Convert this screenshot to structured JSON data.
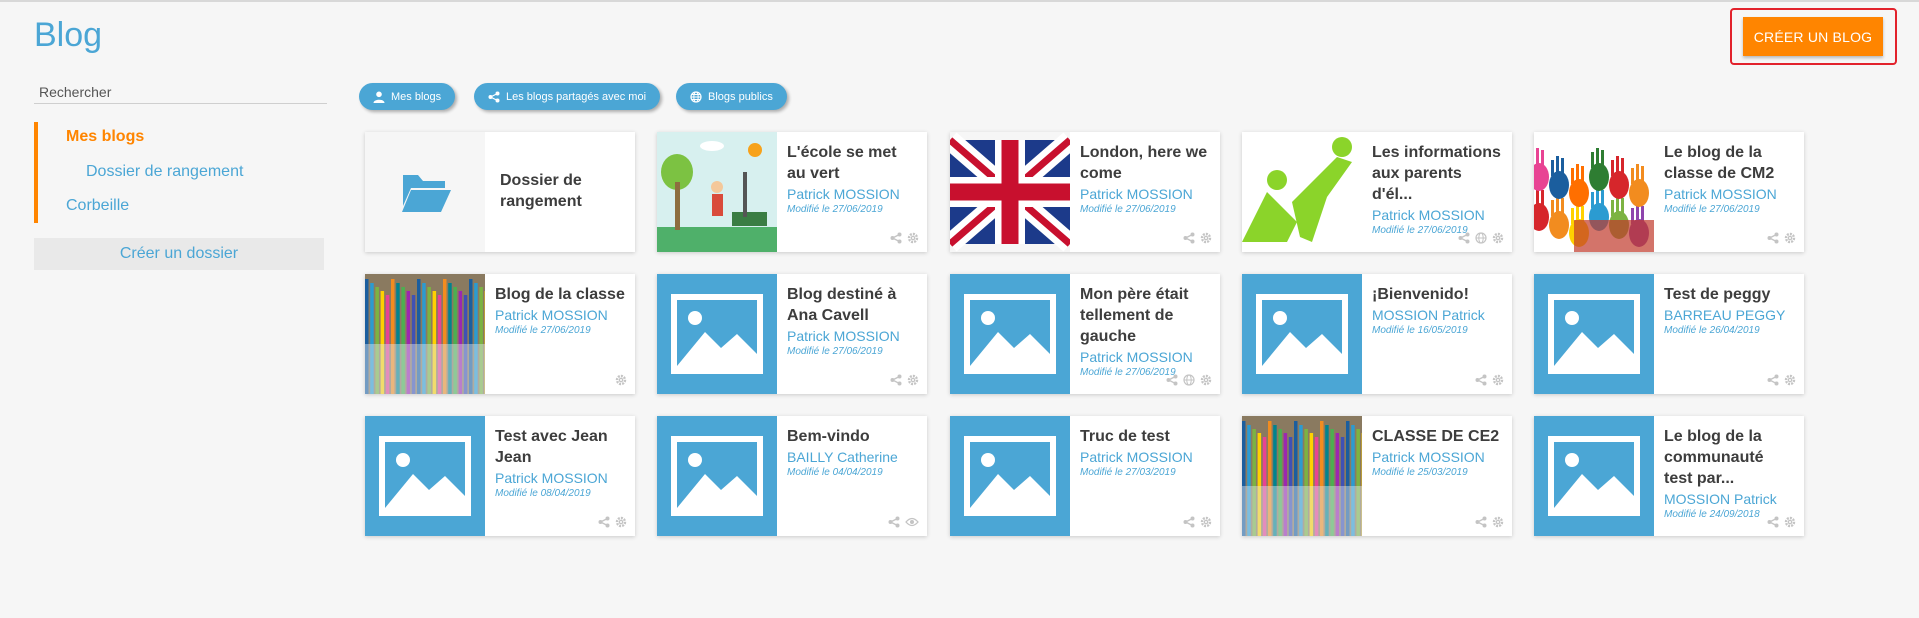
{
  "page": {
    "title": "Blog",
    "create_blog": "CRÉER UN BLOG"
  },
  "search": {
    "placeholder": "Rechercher"
  },
  "sidebar": {
    "items": [
      {
        "label": "Mes blogs",
        "active": true
      },
      {
        "label": "Dossier de rangement"
      },
      {
        "label": "Corbeille"
      }
    ],
    "create_folder": "Créer un dossier"
  },
  "filters": [
    {
      "label": "Mes blogs",
      "icon": "user-icon"
    },
    {
      "label": "Les blogs partagés avec moi",
      "icon": "share-icon"
    },
    {
      "label": "Blogs publics",
      "icon": "globe-icon"
    }
  ],
  "folder_card": {
    "title": "Dossier de rangement",
    "icon": "folder-open-icon"
  },
  "blogs": [
    {
      "title": "L'école se met au vert",
      "author": "Patrick MOSSION",
      "date": "Modifié le 27/06/2019",
      "thumb": "ecole"
    },
    {
      "title": "London, here we come",
      "author": "Patrick MOSSION",
      "date": "Modifié le 27/06/2019",
      "thumb": "uk"
    },
    {
      "title": "Les informations aux parents d'él...",
      "author": "Patrick MOSSION",
      "date": "Modifié le 27/06/2019",
      "thumb": "green"
    },
    {
      "title": "Le blog de la classe de CM2",
      "author": "Patrick MOSSION",
      "date": "Modifié le 27/06/2019",
      "thumb": "hands"
    },
    {
      "title": "Blog de la classe",
      "author": "Patrick MOSSION",
      "date": "Modifié le 27/06/2019",
      "thumb": "pencils"
    },
    {
      "title": "Blog destiné à Ana Cavell",
      "author": "Patrick MOSSION",
      "date": "Modifié le 27/06/2019",
      "thumb": "placeholder"
    },
    {
      "title": "Mon père était tellement de gauche",
      "author": "Patrick MOSSION",
      "date": "Modifié le 27/06/2019",
      "thumb": "placeholder"
    },
    {
      "title": "¡Bienvenido!",
      "author": "MOSSION Patrick",
      "date": "Modifié le 16/05/2019",
      "thumb": "placeholder"
    },
    {
      "title": "Test de peggy",
      "author": "BARREAU PEGGY",
      "date": "Modifié le 26/04/2019",
      "thumb": "placeholder"
    },
    {
      "title": "Test avec Jean Jean",
      "author": "Patrick MOSSION",
      "date": "Modifié le 08/04/2019",
      "thumb": "placeholder"
    },
    {
      "title": "Bem-vindo",
      "author": "BAILLY Catherine",
      "date": "Modifié le 04/04/2019",
      "thumb": "placeholder"
    },
    {
      "title": "Truc de test",
      "author": "Patrick MOSSION",
      "date": "Modifié le 27/03/2019",
      "thumb": "placeholder"
    },
    {
      "title": "CLASSE DE CE2",
      "author": "Patrick MOSSION",
      "date": "Modifié le 25/03/2019",
      "thumb": "pencils"
    },
    {
      "title": "Le blog de la communauté test par...",
      "author": "MOSSION Patrick",
      "date": "Modifié le 24/09/2018",
      "thumb": "placeholder"
    }
  ],
  "colors": {
    "accent": "#ff8500",
    "primary": "#4ba6d5",
    "highlight": "#e2222c"
  }
}
